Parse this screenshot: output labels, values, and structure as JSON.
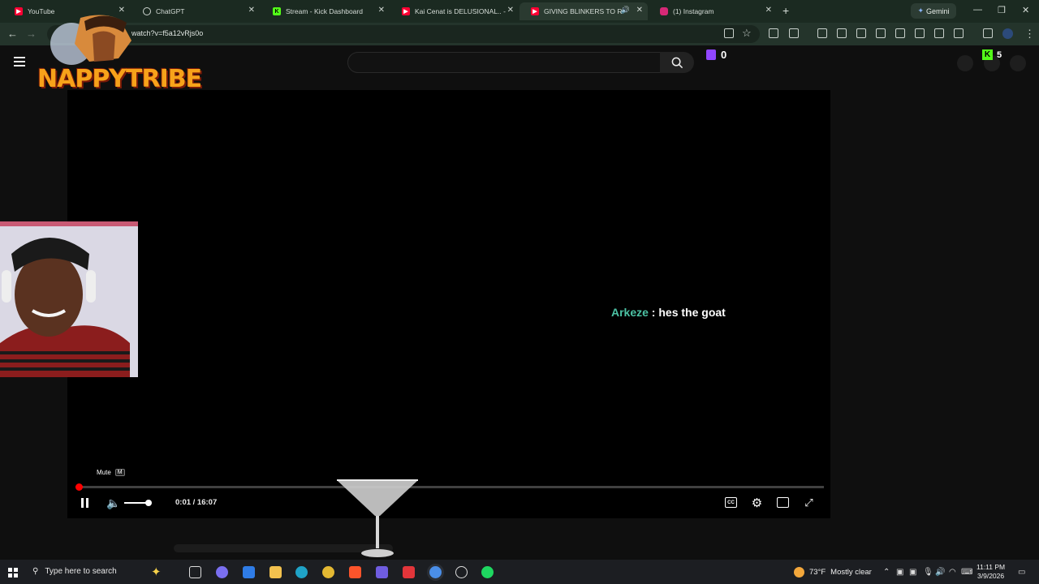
{
  "browser": {
    "tabs": [
      {
        "title": "YouTube",
        "icon": "youtube-icon",
        "color": "#ff0033"
      },
      {
        "title": "ChatGPT",
        "icon": "chatgpt-icon",
        "color": "#cfd6d1"
      },
      {
        "title": "Stream - Kick Dashboard",
        "icon": "kick-icon",
        "color": "#53fc18"
      },
      {
        "title": "Kai Cenat is DELUSIONAL.. - Yo",
        "icon": "youtube-icon",
        "color": "#ff0033"
      },
      {
        "title": "GIVING BLINKERS TO RAND",
        "icon": "youtube-icon",
        "color": "#ff0033"
      },
      {
        "title": "(1) Instagram",
        "icon": "instagram-icon",
        "color": "#d62976"
      }
    ],
    "new_tab": "+",
    "gemini_label": "Gemini",
    "url": "watch?v=f5a12vRjs0o"
  },
  "page": {
    "twitch_count": "0",
    "kick_count": "5"
  },
  "player": {
    "chat_user": "Arkeze",
    "chat_message": " : hes the goat",
    "tooltip_label": "Mute",
    "tooltip_key": "M",
    "time": "0:01 / 16:07",
    "progress_fraction": 0.002
  },
  "overlay": {
    "logo_text": "NAPPYTRIBE"
  },
  "taskbar": {
    "search_placeholder": "Type here to search",
    "weather_temp": "73°F",
    "weather_desc": "Mostly clear",
    "time": "11:11 PM",
    "date": "3/9/2026"
  }
}
